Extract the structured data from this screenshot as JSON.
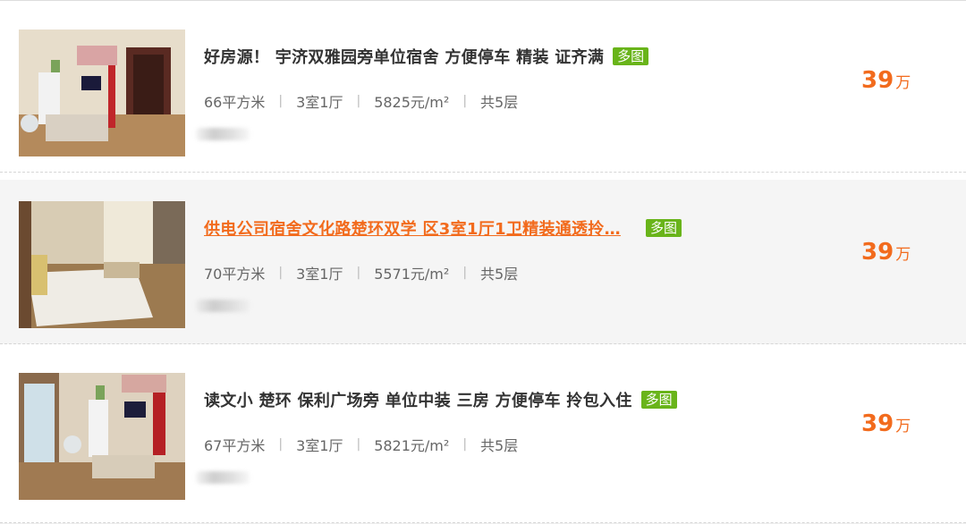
{
  "listings": [
    {
      "title": "好房源！ 宇济双雅园旁单位宿舍 方便停车 精装 证齐满",
      "badge": "多图",
      "area": "66平方米",
      "layout": "3室1厅",
      "unit_price": "5825元/m²",
      "floors": "共5层",
      "price_num": "39",
      "price_unit": "万"
    },
    {
      "title": "供电公司宿舍文化路楚环双学 区3室1厅1卫精装通透拎…",
      "badge": "多图",
      "area": "70平方米",
      "layout": "3室1厅",
      "unit_price": "5571元/m²",
      "floors": "共5层",
      "price_num": "39",
      "price_unit": "万"
    },
    {
      "title": "读文小 楚环 保利广场旁 单位中装 三房 方便停车 拎包入住",
      "badge": "多图",
      "area": "67平方米",
      "layout": "3室1厅",
      "unit_price": "5821元/m²",
      "floors": "共5层",
      "price_num": "39",
      "price_unit": "万"
    }
  ],
  "separator": "|",
  "colors": {
    "accent": "#f26b1d",
    "badge": "#69b41a",
    "title": "#333333",
    "meta": "#666666"
  }
}
